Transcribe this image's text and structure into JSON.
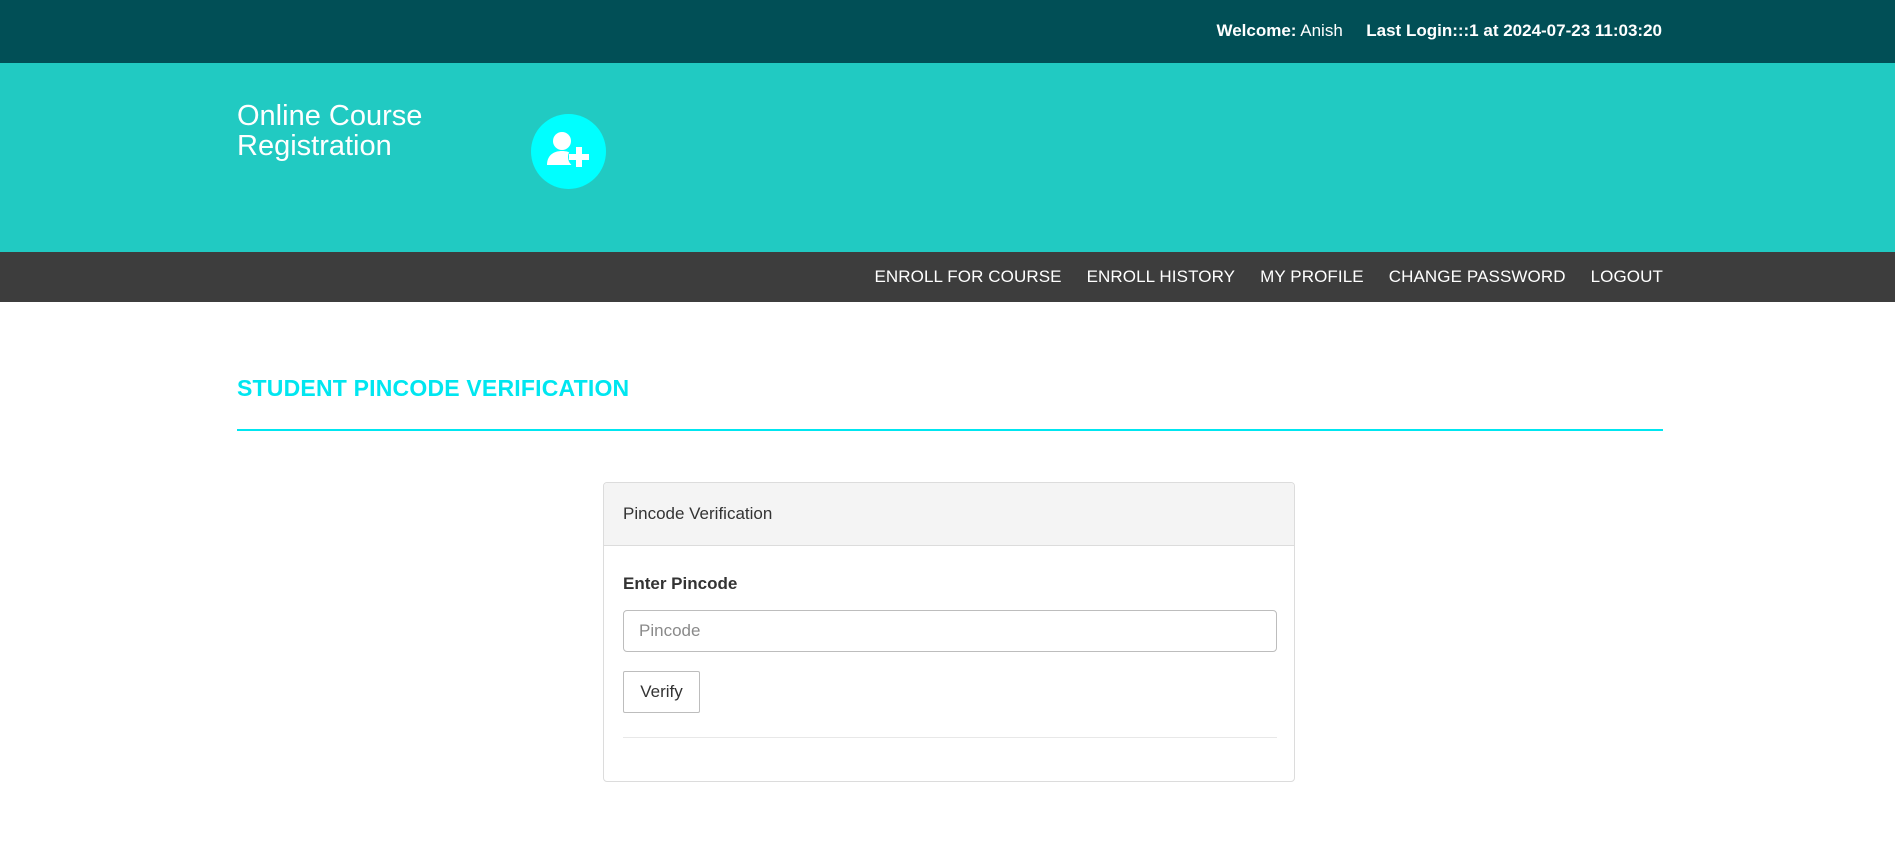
{
  "topbar": {
    "welcome_label": "Welcome:",
    "user_name": "Anish",
    "last_login_text": "Last Login:::1 at 2024-07-23 11:03:20"
  },
  "header": {
    "site_title_line1": "Online Course",
    "site_title_line2": "Registration",
    "logo_icon": "user-plus-icon"
  },
  "nav": {
    "items": [
      {
        "label": "ENROLL FOR COURSE"
      },
      {
        "label": "ENROLL HISTORY"
      },
      {
        "label": "MY PROFILE"
      },
      {
        "label": "CHANGE PASSWORD"
      },
      {
        "label": "LOGOUT"
      }
    ]
  },
  "page": {
    "heading": "STUDENT PINCODE VERIFICATION"
  },
  "panel": {
    "title": "Pincode Verification",
    "field_label": "Enter Pincode",
    "input_placeholder": "Pincode",
    "input_value": "",
    "button_label": "Verify"
  },
  "colors": {
    "topbar": "#014f56",
    "header": "#21cac2",
    "navbar": "#3d3d3d",
    "accent": "#00e6f0"
  }
}
